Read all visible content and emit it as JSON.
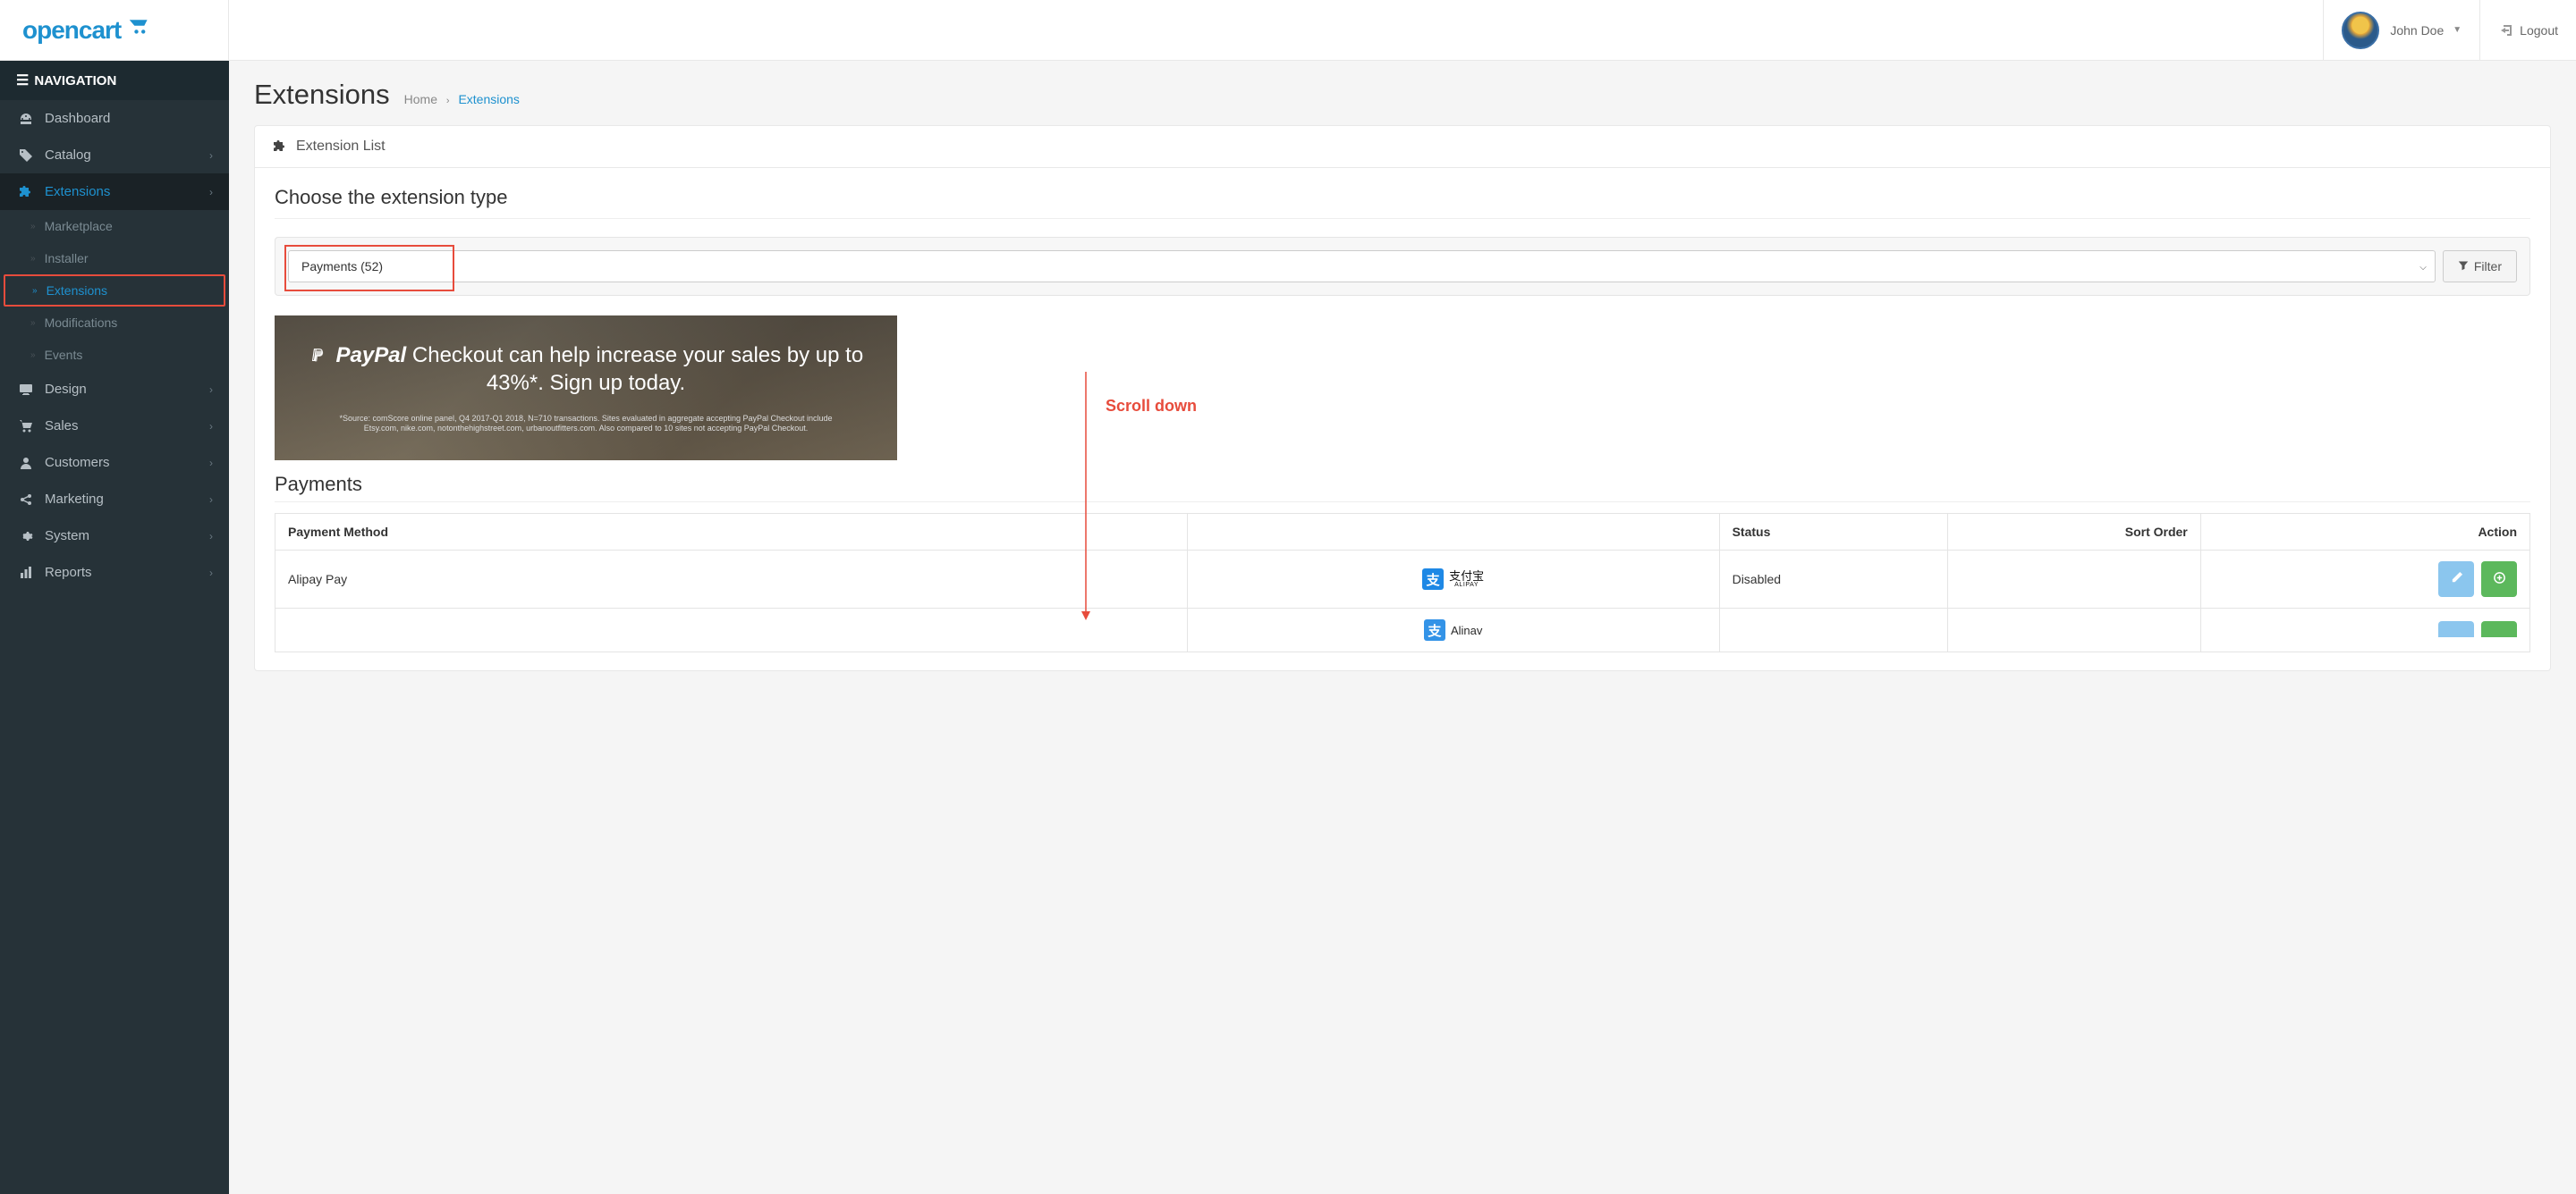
{
  "brand": "opencart",
  "user": {
    "name": "John Doe"
  },
  "logout_label": "Logout",
  "nav_heading": "NAVIGATION",
  "sidebar": {
    "items": [
      {
        "label": "Dashboard",
        "icon": "dashboard"
      },
      {
        "label": "Catalog",
        "icon": "tag",
        "expandable": true
      },
      {
        "label": "Extensions",
        "icon": "puzzle",
        "expandable": true,
        "active": true
      },
      {
        "label": "Design",
        "icon": "monitor",
        "expandable": true
      },
      {
        "label": "Sales",
        "icon": "cart",
        "expandable": true
      },
      {
        "label": "Customers",
        "icon": "user",
        "expandable": true
      },
      {
        "label": "Marketing",
        "icon": "share",
        "expandable": true
      },
      {
        "label": "System",
        "icon": "gear",
        "expandable": true
      },
      {
        "label": "Reports",
        "icon": "bars",
        "expandable": true
      }
    ],
    "extensions_children": [
      {
        "label": "Marketplace"
      },
      {
        "label": "Installer"
      },
      {
        "label": "Extensions",
        "active": true
      },
      {
        "label": "Modifications"
      },
      {
        "label": "Events"
      }
    ]
  },
  "page": {
    "title": "Extensions",
    "breadcrumb": {
      "home": "Home",
      "current": "Extensions"
    },
    "panel_title": "Extension List",
    "choose_label": "Choose the extension type",
    "filter_select": "Payments (52)",
    "filter_button": "Filter",
    "banner": {
      "paypal": "PayPal",
      "line1": " Checkout can help increase your sales by up to 43%*. Sign up today.",
      "fine": "*Source: comScore online panel, Q4 2017-Q1 2018, N=710 transactions. Sites evaluated in aggregate accepting PayPal Checkout include Etsy.com, nike.com, notonthehighstreet.com, urbanoutfitters.com. Also compared to 10 sites not accepting PayPal Checkout."
    },
    "section_title": "Payments",
    "table": {
      "headers": {
        "method": "Payment Method",
        "logo": "",
        "status": "Status",
        "sort": "Sort Order",
        "action": "Action"
      },
      "rows": [
        {
          "method": "Alipay Pay",
          "logo_cn": "支付宝",
          "logo_en": "ALIPAY",
          "status": "Disabled",
          "sort": ""
        }
      ]
    }
  },
  "annotation": {
    "label": "Scroll down"
  }
}
